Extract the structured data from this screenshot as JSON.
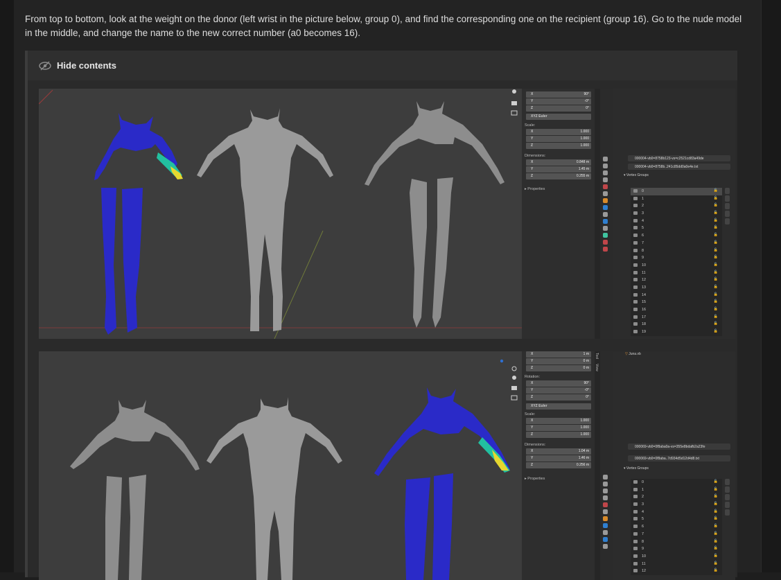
{
  "post": {
    "intro": "From top to bottom, look at the weight on the donor (left wrist in the picture below, group 0), and find the corresponding one on the recipient (group 16).  Go to the nude model in the middle, and change the name to the new correct number (a0 becomes 16).",
    "spoiler_label": "Hide contents",
    "icon": "eye-slash-icon"
  },
  "shot1": {
    "npanel": {
      "rot": [
        {
          "axis": "X",
          "value": "90°"
        },
        {
          "axis": "Y",
          "value": "-0°"
        },
        {
          "axis": "Z",
          "value": "0°"
        }
      ],
      "mode": "XYZ Euler",
      "scale_label": "Scale:",
      "scale": [
        {
          "axis": "X",
          "value": "1.000"
        },
        {
          "axis": "Y",
          "value": "1.000"
        },
        {
          "axis": "Z",
          "value": "1.000"
        }
      ],
      "dims_label": "Dimensions:",
      "dims": [
        {
          "axis": "X",
          "value": "0.848 m"
        },
        {
          "axis": "Y",
          "value": "1.45 m"
        },
        {
          "axis": "Z",
          "value": "0.255 m"
        }
      ],
      "properties": "▸ Properties"
    },
    "props": {
      "object": "000004-vb0=8758b123-vs=c2521cd83a49de",
      "mesh": "000004-vb0=8758b..241c85dd0a0e4e.txt",
      "section": "▾ Vertex Groups",
      "groups": [
        "0",
        "1",
        "2",
        "3",
        "4",
        "5",
        "6",
        "7",
        "8",
        "9",
        "10",
        "11",
        "12",
        "13",
        "14",
        "15",
        "16",
        "17",
        "18",
        "19"
      ]
    }
  },
  "shot2": {
    "npanel": {
      "loc": [
        {
          "axis": "X",
          "value": "1 m"
        },
        {
          "axis": "Y",
          "value": "0 m"
        },
        {
          "axis": "Z",
          "value": "0 m"
        }
      ],
      "rot_label": "Rotation:",
      "rot": [
        {
          "axis": "X",
          "value": "90°"
        },
        {
          "axis": "Y",
          "value": "-0°"
        },
        {
          "axis": "Z",
          "value": "0°"
        }
      ],
      "mode": "XYZ Euler",
      "scale_label": "Scale:",
      "scale": [
        {
          "axis": "X",
          "value": "1.000"
        },
        {
          "axis": "Y",
          "value": "1.000"
        },
        {
          "axis": "Z",
          "value": "1.000"
        }
      ],
      "dims_label": "Dimensions:",
      "dims": [
        {
          "axis": "X",
          "value": "1.04 m"
        },
        {
          "axis": "Y",
          "value": "1.46 m"
        },
        {
          "axis": "Z",
          "value": "0.256 m"
        }
      ],
      "properties": "▸ Properties",
      "tabs": [
        "Tool",
        "View"
      ]
    },
    "props": {
      "outliner_item": "Juna.vb",
      "object": "000069-vb0=0f8aba0a-vs=355e8bdafb2a23fe",
      "mesh": "000069-vb0=0f8aba..7d934d5d12d4d8.txt",
      "section": "▾ Vertex Groups",
      "groups": [
        "0",
        "1",
        "2",
        "3",
        "4",
        "5",
        "6",
        "7",
        "8",
        "9",
        "10",
        "11",
        "12"
      ]
    }
  },
  "colors": {
    "accent_blue": "#2a2ac8",
    "weight_ramp": [
      "#1f2fd0",
      "#22c08a",
      "#e6e630",
      "#f0a020"
    ],
    "body_grey": "#9a9a9a",
    "selection": "#4b4b4b"
  }
}
